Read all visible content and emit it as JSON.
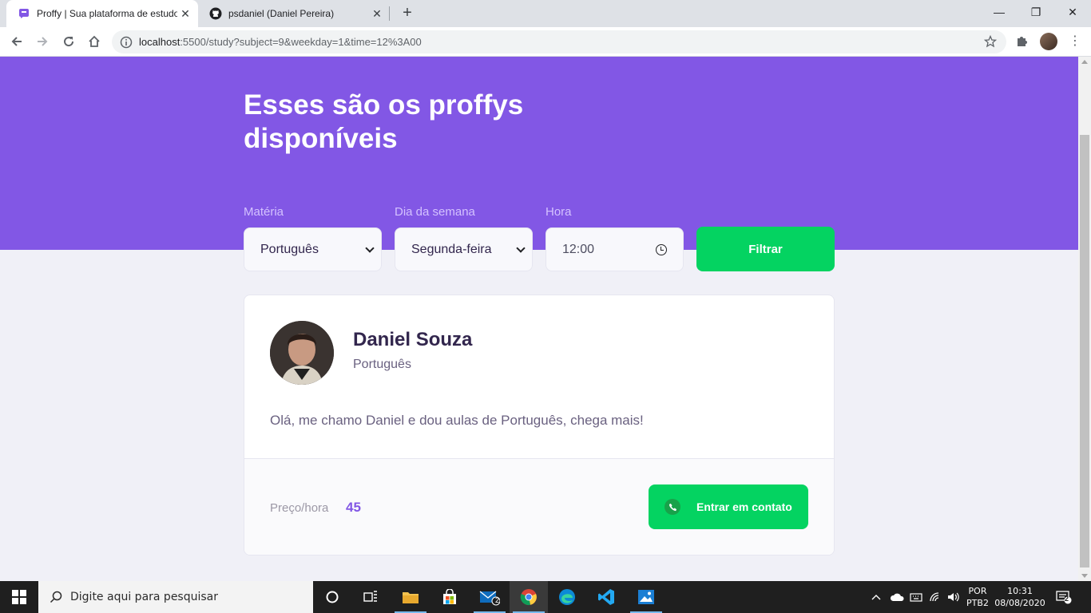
{
  "browser": {
    "tabs": [
      {
        "title": "Proffy | Sua plataforma de estudos",
        "favicon": "proffy-icon",
        "active": true
      },
      {
        "title": "psdaniel (Daniel Pereira)",
        "favicon": "github-icon",
        "active": false
      }
    ],
    "url_host": "localhost",
    "url_rest": ":5500/study?subject=9&weekday=1&time=12%3A00"
  },
  "page": {
    "title": "Esses são os proffys disponíveis",
    "filters": {
      "subject_label": "Matéria",
      "subject_value": "Português",
      "weekday_label": "Dia da semana",
      "weekday_value": "Segunda-feira",
      "time_label": "Hora",
      "time_value": "12:00",
      "submit_label": "Filtrar"
    },
    "teacher": {
      "name": "Daniel Souza",
      "subject": "Português",
      "bio": "Olá, me chamo Daniel e dou aulas de Português, chega mais!",
      "price_label": "Preço/hora",
      "price_value": "45",
      "contact_label": "Entrar em contato"
    }
  },
  "colors": {
    "primary": "#8257e5",
    "secondary": "#04d361",
    "background": "#f0f0f7",
    "title_text": "#32264d"
  },
  "taskbar": {
    "search_placeholder": "Digite aqui para pesquisar",
    "language_top": "POR",
    "language_bottom": "PTB2",
    "time": "10:31",
    "date": "08/08/2020",
    "mail_badge": "2",
    "notification_count": "2"
  }
}
